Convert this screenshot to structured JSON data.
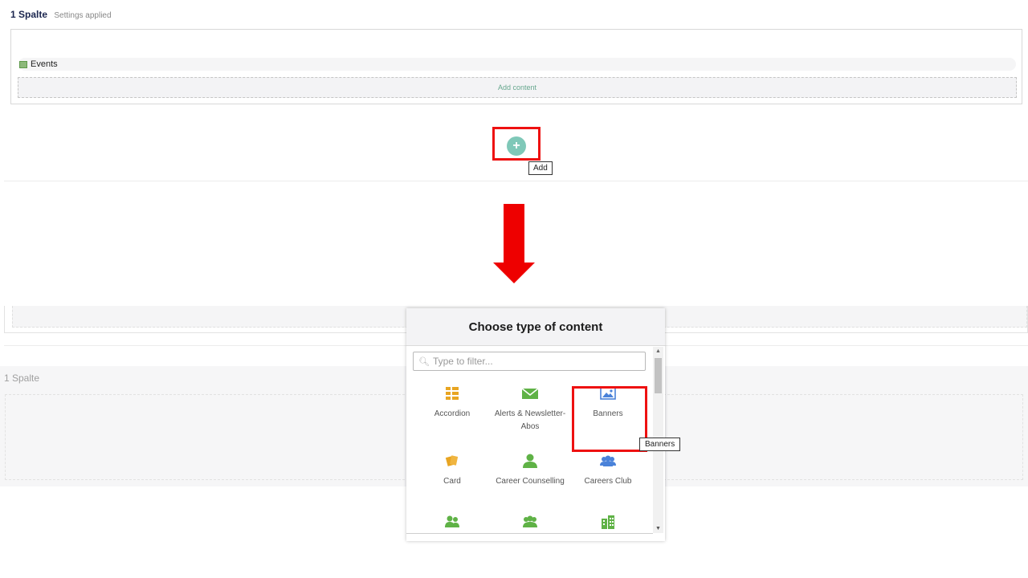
{
  "top_panel": {
    "title": "1 Spalte",
    "subtitle": "Settings applied",
    "events_label": "Events",
    "add_content_label": "Add content"
  },
  "add_button": {
    "symbol": "+",
    "tooltip": "Add"
  },
  "background": {
    "section_label": "1 Spalte"
  },
  "dialog": {
    "title": "Choose type of content",
    "filter_placeholder": "Type to filter...",
    "items": [
      {
        "label": "Accordion",
        "icon": "accordion-icon",
        "color": "#e8a522"
      },
      {
        "label": "Alerts & Newsletter-Abos",
        "icon": "envelope-icon",
        "color": "#5fb246"
      },
      {
        "label": "Banners",
        "icon": "image-icon",
        "color": "#4a82d9"
      },
      {
        "label": "Card",
        "icon": "cards-icon",
        "color": "#e8a522"
      },
      {
        "label": "Career Counselling",
        "icon": "person-icon",
        "color": "#5fb246"
      },
      {
        "label": "Careers Club",
        "icon": "group-icon",
        "color": "#4a82d9"
      },
      {
        "label": "",
        "icon": "people-icon",
        "color": "#5fb246"
      },
      {
        "label": "",
        "icon": "people-icon",
        "color": "#5fb246"
      },
      {
        "label": "",
        "icon": "building-icon",
        "color": "#5fb246"
      }
    ],
    "banner_tooltip": "Banners"
  },
  "accent_colors": {
    "highlight_red": "#ee1111",
    "arrow_red": "#ee0000",
    "add_teal": "#7fc8b8"
  }
}
